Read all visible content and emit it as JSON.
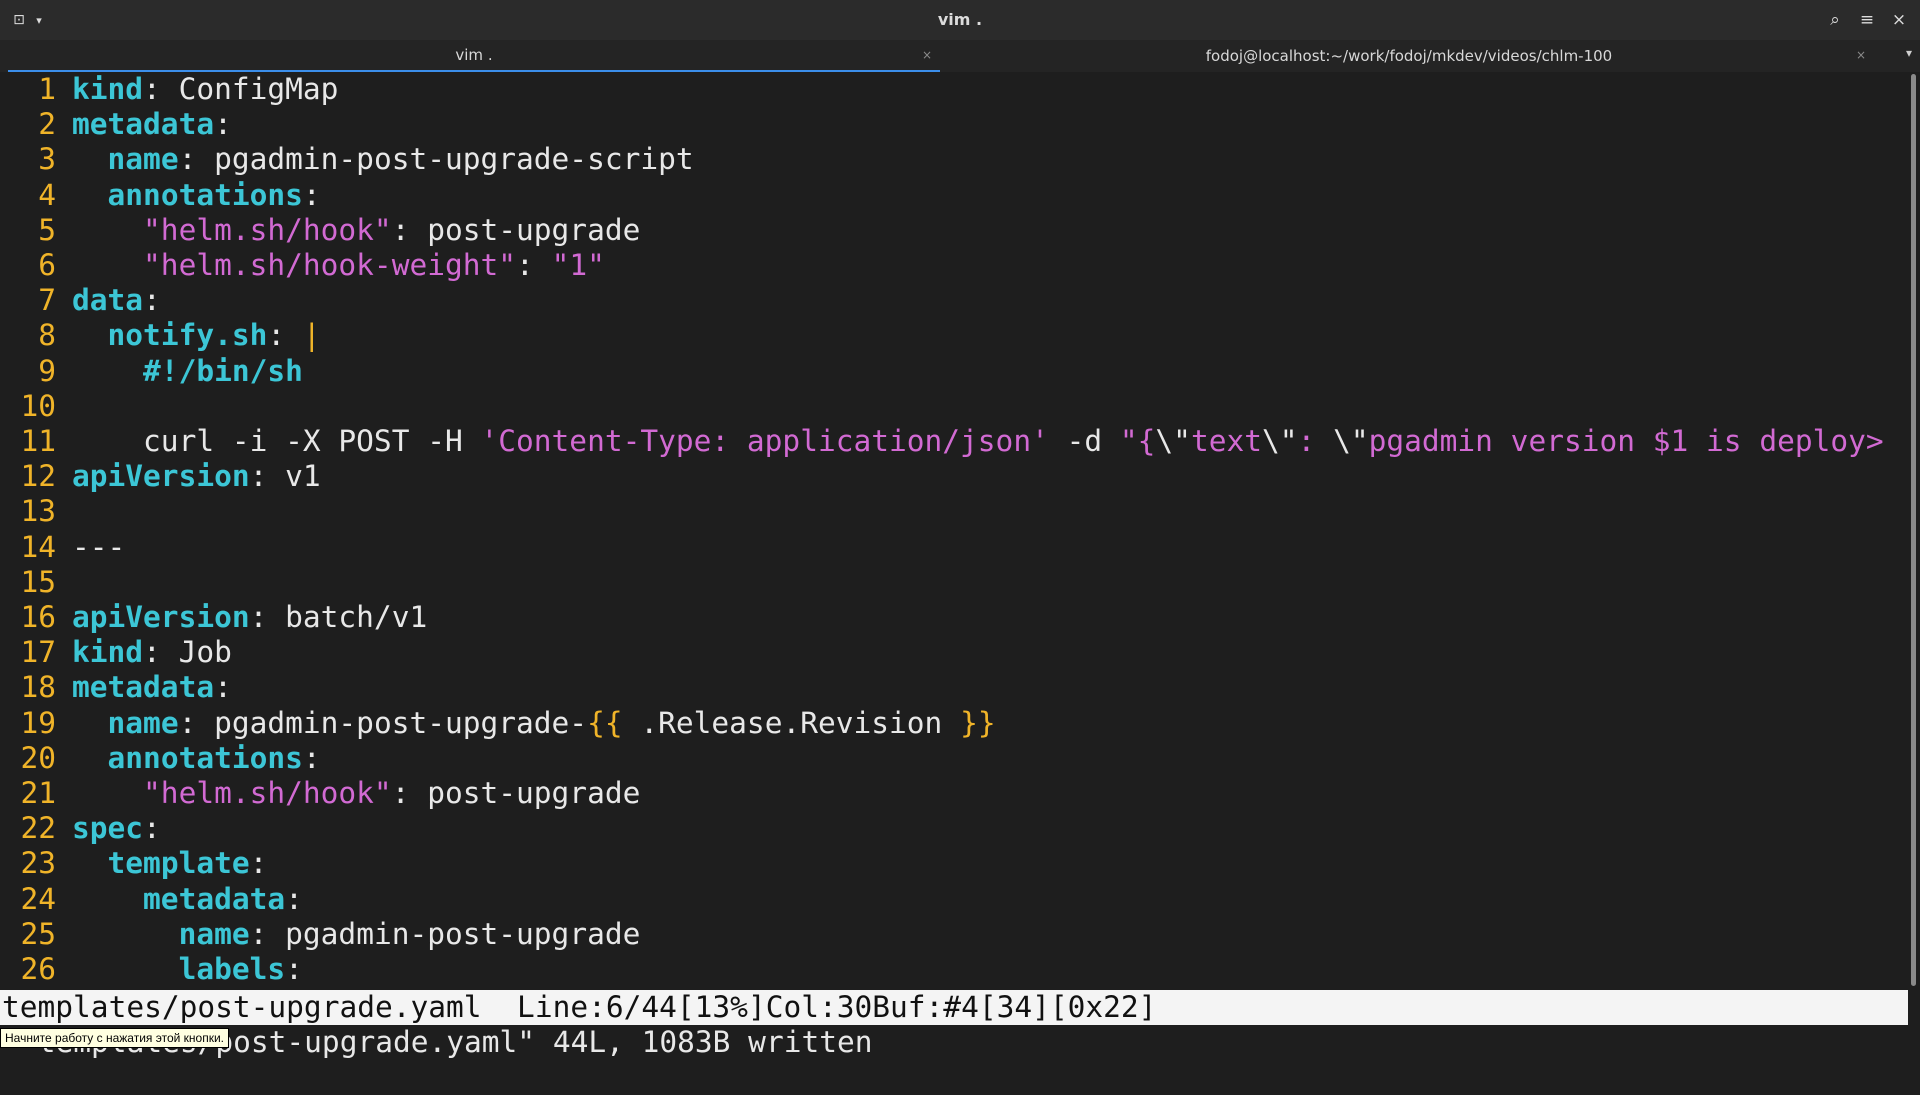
{
  "window": {
    "title": "vim .",
    "buttons": {
      "new_tab": "⊡",
      "new_tab_menu": "▾",
      "search": "⌕",
      "menu": "≡",
      "close": "×"
    }
  },
  "tabs": [
    {
      "label": "vim .",
      "active": true,
      "close": "×"
    },
    {
      "label": "fodoj@localhost:~/work/fodoj/mkdev/videos/chlm-100",
      "active": false,
      "close": "×"
    }
  ],
  "tab_dropdown": "▾",
  "editor": {
    "lines": [
      {
        "n": "1",
        "segs": [
          [
            "k",
            "kind"
          ],
          [
            "w",
            ": ConfigMap"
          ]
        ]
      },
      {
        "n": "2",
        "segs": [
          [
            "k",
            "metadata"
          ],
          [
            "w",
            ":"
          ]
        ]
      },
      {
        "n": "3",
        "segs": [
          [
            "w",
            "  "
          ],
          [
            "k",
            "name"
          ],
          [
            "w",
            ": pgadmin-post-upgrade-script"
          ]
        ]
      },
      {
        "n": "4",
        "segs": [
          [
            "w",
            "  "
          ],
          [
            "k",
            "annotations"
          ],
          [
            "w",
            ":"
          ]
        ]
      },
      {
        "n": "5",
        "segs": [
          [
            "w",
            "    "
          ],
          [
            "s",
            "\"helm.sh/hook\""
          ],
          [
            "w",
            ": post-upgrade"
          ]
        ]
      },
      {
        "n": "6",
        "segs": [
          [
            "w",
            "    "
          ],
          [
            "s",
            "\"helm.sh/hook-weight\""
          ],
          [
            "w",
            ": "
          ],
          [
            "s",
            "\"1\""
          ]
        ]
      },
      {
        "n": "7",
        "segs": [
          [
            "k",
            "data"
          ],
          [
            "w",
            ":"
          ]
        ]
      },
      {
        "n": "8",
        "segs": [
          [
            "w",
            "  "
          ],
          [
            "k",
            "notify.sh"
          ],
          [
            "w",
            ": "
          ],
          [
            "y",
            "|"
          ]
        ]
      },
      {
        "n": "9",
        "segs": [
          [
            "w",
            "    "
          ],
          [
            "k",
            "#!/bin/sh"
          ]
        ]
      },
      {
        "n": "10",
        "segs": []
      },
      {
        "n": "11",
        "segs": [
          [
            "w",
            "    curl -i -X POST -H "
          ],
          [
            "s",
            "'Content-Type: application/json'"
          ],
          [
            "w",
            " -d "
          ],
          [
            "s",
            "\"{"
          ],
          [
            "w",
            "\\\""
          ],
          [
            "s",
            "text"
          ],
          [
            "w",
            "\\\""
          ],
          [
            "s",
            ": "
          ],
          [
            "w",
            "\\\""
          ],
          [
            "s",
            "pgadmin version $1 is deploy>"
          ]
        ]
      },
      {
        "n": "12",
        "segs": [
          [
            "k",
            "apiVersion"
          ],
          [
            "w",
            ": v1"
          ]
        ]
      },
      {
        "n": "13",
        "segs": []
      },
      {
        "n": "14",
        "segs": [
          [
            "w",
            "---"
          ]
        ]
      },
      {
        "n": "15",
        "segs": []
      },
      {
        "n": "16",
        "segs": [
          [
            "k",
            "apiVersion"
          ],
          [
            "w",
            ": batch/v1"
          ]
        ]
      },
      {
        "n": "17",
        "segs": [
          [
            "k",
            "kind"
          ],
          [
            "w",
            ": Job"
          ]
        ]
      },
      {
        "n": "18",
        "segs": [
          [
            "k",
            "metadata"
          ],
          [
            "w",
            ":"
          ]
        ]
      },
      {
        "n": "19",
        "segs": [
          [
            "w",
            "  "
          ],
          [
            "k",
            "name"
          ],
          [
            "w",
            ": pgadmin-post-upgrade-"
          ],
          [
            "y",
            "{{"
          ],
          [
            "w",
            " .Release.Revision "
          ],
          [
            "y",
            "}}"
          ]
        ]
      },
      {
        "n": "20",
        "segs": [
          [
            "w",
            "  "
          ],
          [
            "k",
            "annotations"
          ],
          [
            "w",
            ":"
          ]
        ]
      },
      {
        "n": "21",
        "segs": [
          [
            "w",
            "    "
          ],
          [
            "s",
            "\"helm.sh/hook\""
          ],
          [
            "w",
            ": post-upgrade"
          ]
        ]
      },
      {
        "n": "22",
        "segs": [
          [
            "k",
            "spec"
          ],
          [
            "w",
            ":"
          ]
        ]
      },
      {
        "n": "23",
        "segs": [
          [
            "w",
            "  "
          ],
          [
            "k",
            "template"
          ],
          [
            "w",
            ":"
          ]
        ]
      },
      {
        "n": "24",
        "segs": [
          [
            "w",
            "    "
          ],
          [
            "k",
            "metadata"
          ],
          [
            "w",
            ":"
          ]
        ]
      },
      {
        "n": "25",
        "segs": [
          [
            "w",
            "      "
          ],
          [
            "k",
            "name"
          ],
          [
            "w",
            ": pgadmin-post-upgrade"
          ]
        ]
      },
      {
        "n": "26",
        "segs": [
          [
            "w",
            "      "
          ],
          [
            "k",
            "labels"
          ],
          [
            "w",
            ":"
          ]
        ]
      }
    ]
  },
  "statusline": "templates/post-upgrade.yaml  Line:6/44[13%]Col:30Buf:#4[34][0x22]",
  "message": "\"templates/post-upgrade.yaml\" 44L, 1083B written",
  "tooltip": "Начните работу с нажатия этой кнопки."
}
